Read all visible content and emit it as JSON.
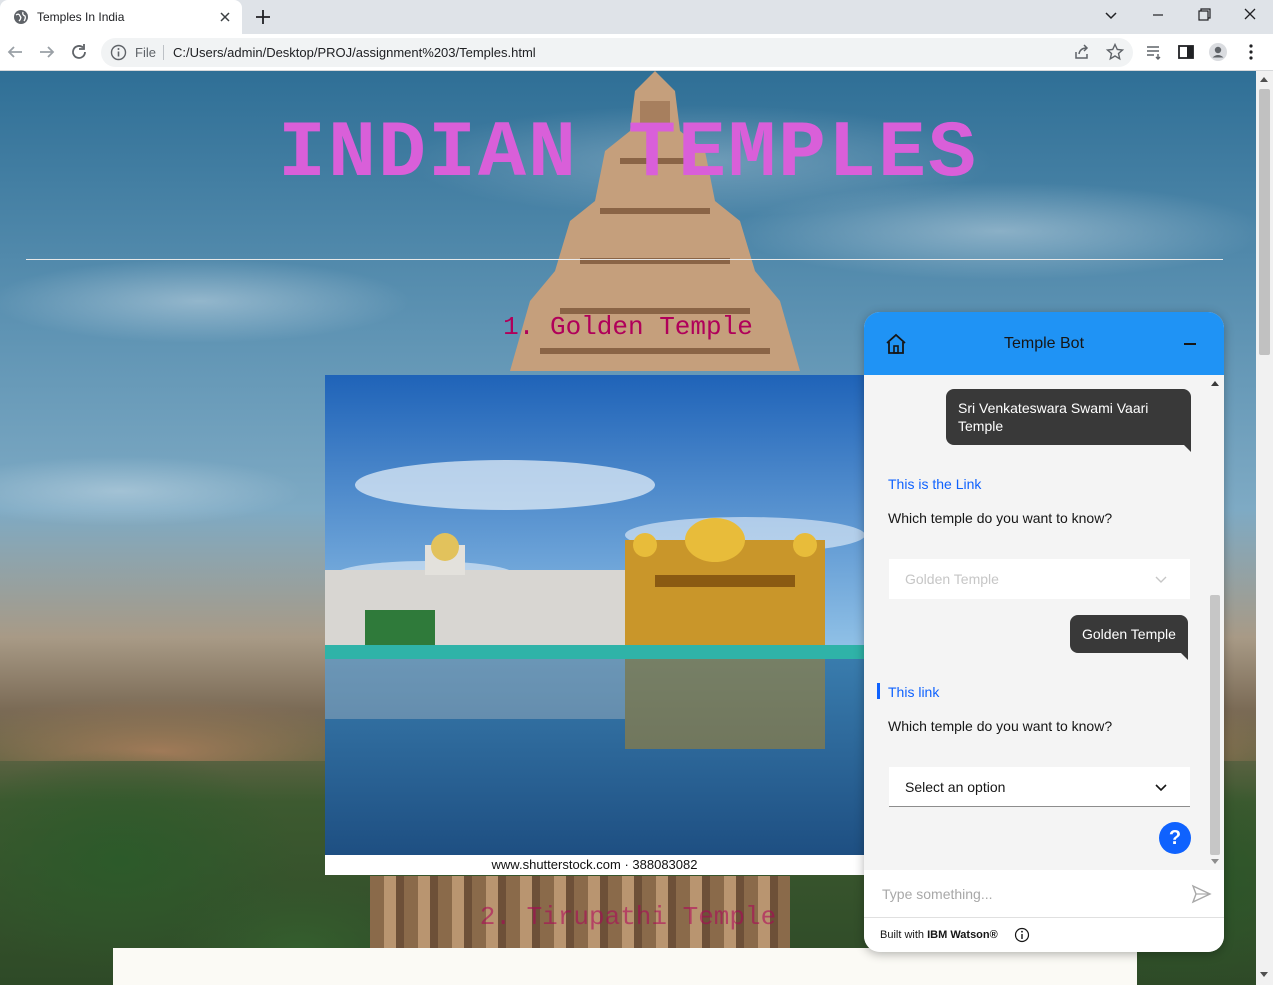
{
  "browser": {
    "tab_title": "Temples In India",
    "address_protocol": "File",
    "address_url": "C:/Users/admin/Desktop/PROJ/assignment%203/Temples.html"
  },
  "page": {
    "title": "INDIAN TEMPLES",
    "sections": [
      {
        "heading": "1. Golden Temple",
        "image_caption": "www.shutterstock.com · 388083082"
      },
      {
        "heading": "2. Tirupathi Temple"
      }
    ]
  },
  "chat": {
    "title": "Temple Bot",
    "messages": {
      "user_1": "Sri Venkateswara Swami Vaari Temple",
      "link_1": "This is the Link",
      "question_1": "Which temple do you want to know?",
      "dropdown_1_value": "Golden Temple",
      "user_2": "Golden Temple",
      "link_2": "This link",
      "question_2": "Which temple do you want to know?",
      "dropdown_2_placeholder": "Select an option"
    },
    "help_label": "?",
    "input_placeholder": "Type something...",
    "footer_prefix": "Built with",
    "footer_brand": "IBM Watson®"
  },
  "colors": {
    "title": "#d95fd9",
    "section_heading": "#b0005a",
    "chat_header": "#1f93f5",
    "link": "#0f62fe"
  }
}
